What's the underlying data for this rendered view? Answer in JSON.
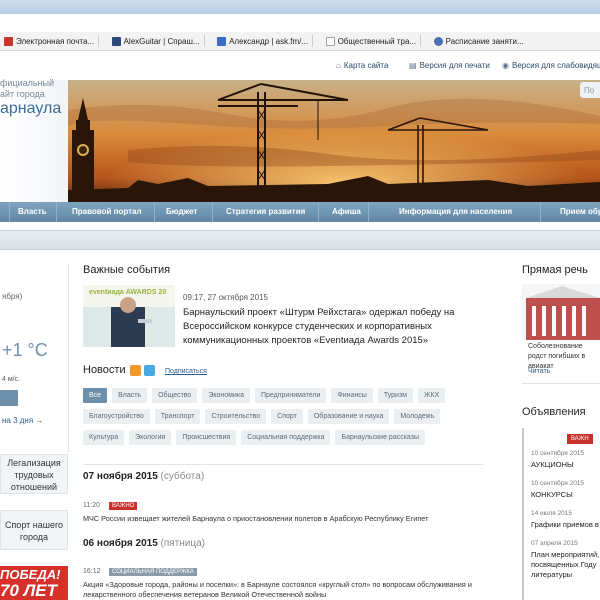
{
  "browser": {
    "bookmarks": [
      {
        "label": "Электронная почта...",
        "icon": "mail-icon",
        "color": "#c8372d"
      },
      {
        "label": "AlexGuitar | Спраш...",
        "icon": "site-icon",
        "color": "#2b4a7a"
      },
      {
        "label": "Александр | ask.fm/...",
        "icon": "askfm-icon",
        "color": "#3a6bc7"
      },
      {
        "label": "Общественный тра...",
        "icon": "page-icon",
        "color": "#9aa3ab"
      },
      {
        "label": "Расписание заняти...",
        "icon": "schedule-icon",
        "color": "#4a6fb0"
      }
    ]
  },
  "header": {
    "title_line1": "фициальный",
    "title_line2": "айт города",
    "title_city": "арнаула",
    "links": {
      "sitemap": "Карта сайта",
      "print": "Версия для печати",
      "low_vision": "Версия для слабовидящих"
    },
    "search_placeholder": "По"
  },
  "nav": {
    "items": [
      "Власть",
      "Правовой портал",
      "Бюджет",
      "Стратегия развития",
      "Афиша",
      "Информация для населения",
      "Прием обр"
    ]
  },
  "left": {
    "weather_date": "ября)",
    "temperature": "+1 °C",
    "wind": "4 м/с.",
    "forecast_link": "на 3 дня →",
    "box1": "Легализация трудовых отношений",
    "box2": "Спорт нашего города",
    "promo_line1": "ПОБЕДА!",
    "promo_line2": "70 ЛЕТ"
  },
  "main": {
    "events_title": "Важные события",
    "event": {
      "timestamp": "09:17, 27 октября 2015",
      "text": "Барнаульский проект «Штурм Рейхстага» одержал победу на Всероссийском конкурсе студенческих и корпоративных коммуникационных проектов «Eventиада Awards 2015»",
      "image_text": "eventиада AWARDS 20"
    },
    "news_title": "Новости",
    "subscribe": "Подписаться",
    "tags": [
      {
        "label": "Все",
        "active": true
      },
      {
        "label": "Власть"
      },
      {
        "label": "Общество"
      },
      {
        "label": "Экономика"
      },
      {
        "label": "Предприниматели"
      },
      {
        "label": "Финансы"
      },
      {
        "label": "Туризм"
      },
      {
        "label": "ЖКХ"
      },
      {
        "label": "Благоустройство"
      },
      {
        "label": "Транспорт"
      },
      {
        "label": "Строительство"
      },
      {
        "label": "Спорт"
      },
      {
        "label": "Образование и наука"
      },
      {
        "label": "Молодежь"
      },
      {
        "label": "Культура"
      },
      {
        "label": "Экология"
      },
      {
        "label": "Происшествия"
      },
      {
        "label": "Социальная поддержка"
      },
      {
        "label": "Барнаульские рассказы"
      }
    ],
    "day1": {
      "date": "07 ноября 2015",
      "weekday": "(суббота)"
    },
    "news1": {
      "time": "11:20",
      "badge": "важно",
      "badge_color": "#c9302c",
      "text": "МЧС России извещает жителей Барнаула о приостановлении полетов в Арабскую Республику Египет"
    },
    "day2": {
      "date": "06 ноября 2015",
      "weekday": "(пятница)"
    },
    "news2": {
      "time": "16:12",
      "badge": "социальная поддержка",
      "badge_color": "#8a9aa8",
      "text": "Акция «Здоровые города, районы и поселки»: в Барнауле состоялся «круглый стол» по вопросам обслуживания и лекарственного обеспечения ветеранов Великой Отечественной войны"
    }
  },
  "right": {
    "speech_title": "Прямая речь",
    "speech_text": "Соболезнование родст погибших в авиакат",
    "read_link": "Читать",
    "ads_title": "Объявления",
    "ads_badge": "важн",
    "ads": [
      {
        "date": "10 сентября 2015",
        "text": "АУКЦИОНЫ"
      },
      {
        "date": "10 сентября 2015",
        "text": "КОНКУРСЫ"
      },
      {
        "date": "14 июля 2015",
        "text": "Графики приемов в"
      },
      {
        "date": "07 апреля 2015",
        "text": "План мероприятий, посвященных Году литературы"
      }
    ]
  }
}
